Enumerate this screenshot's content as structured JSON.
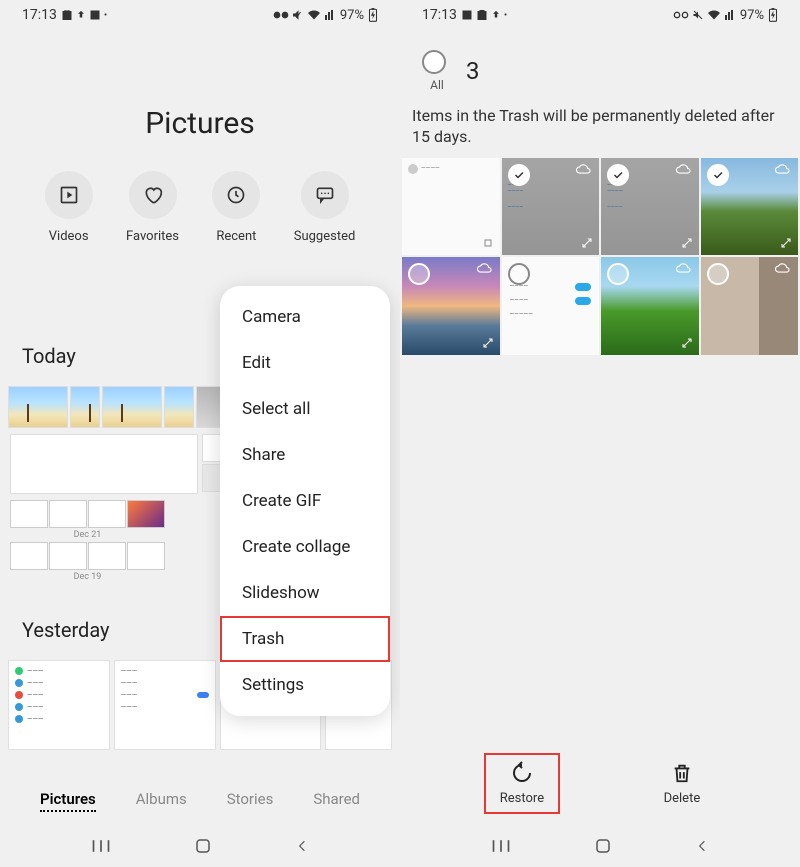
{
  "status": {
    "time": "17:13",
    "battery_pct": "97%"
  },
  "left": {
    "title": "Pictures",
    "categories": [
      {
        "icon": "play-box-icon",
        "label": "Videos"
      },
      {
        "icon": "heart-icon",
        "label": "Favorites"
      },
      {
        "icon": "clock-icon",
        "label": "Recent"
      },
      {
        "icon": "speech-icon",
        "label": "Suggested"
      }
    ],
    "sections": [
      {
        "header": "Today"
      },
      {
        "header": "Yesterday"
      }
    ],
    "tabs": [
      {
        "label": "Pictures",
        "active": true
      },
      {
        "label": "Albums",
        "active": false
      },
      {
        "label": "Stories",
        "active": false
      },
      {
        "label": "Shared",
        "active": false
      }
    ],
    "menu": [
      "Camera",
      "Edit",
      "Select all",
      "Share",
      "Create GIF",
      "Create collage",
      "Slideshow",
      "Trash",
      "Settings"
    ],
    "menu_highlight_index": 7
  },
  "right": {
    "select_count": "3",
    "all_label": "All",
    "note": "Items in the Trash will be permanently deleted after 15 days.",
    "actions": [
      {
        "icon": "restore-icon",
        "label": "Restore",
        "highlighted": true
      },
      {
        "icon": "trash-icon",
        "label": "Delete",
        "highlighted": false
      }
    ]
  }
}
